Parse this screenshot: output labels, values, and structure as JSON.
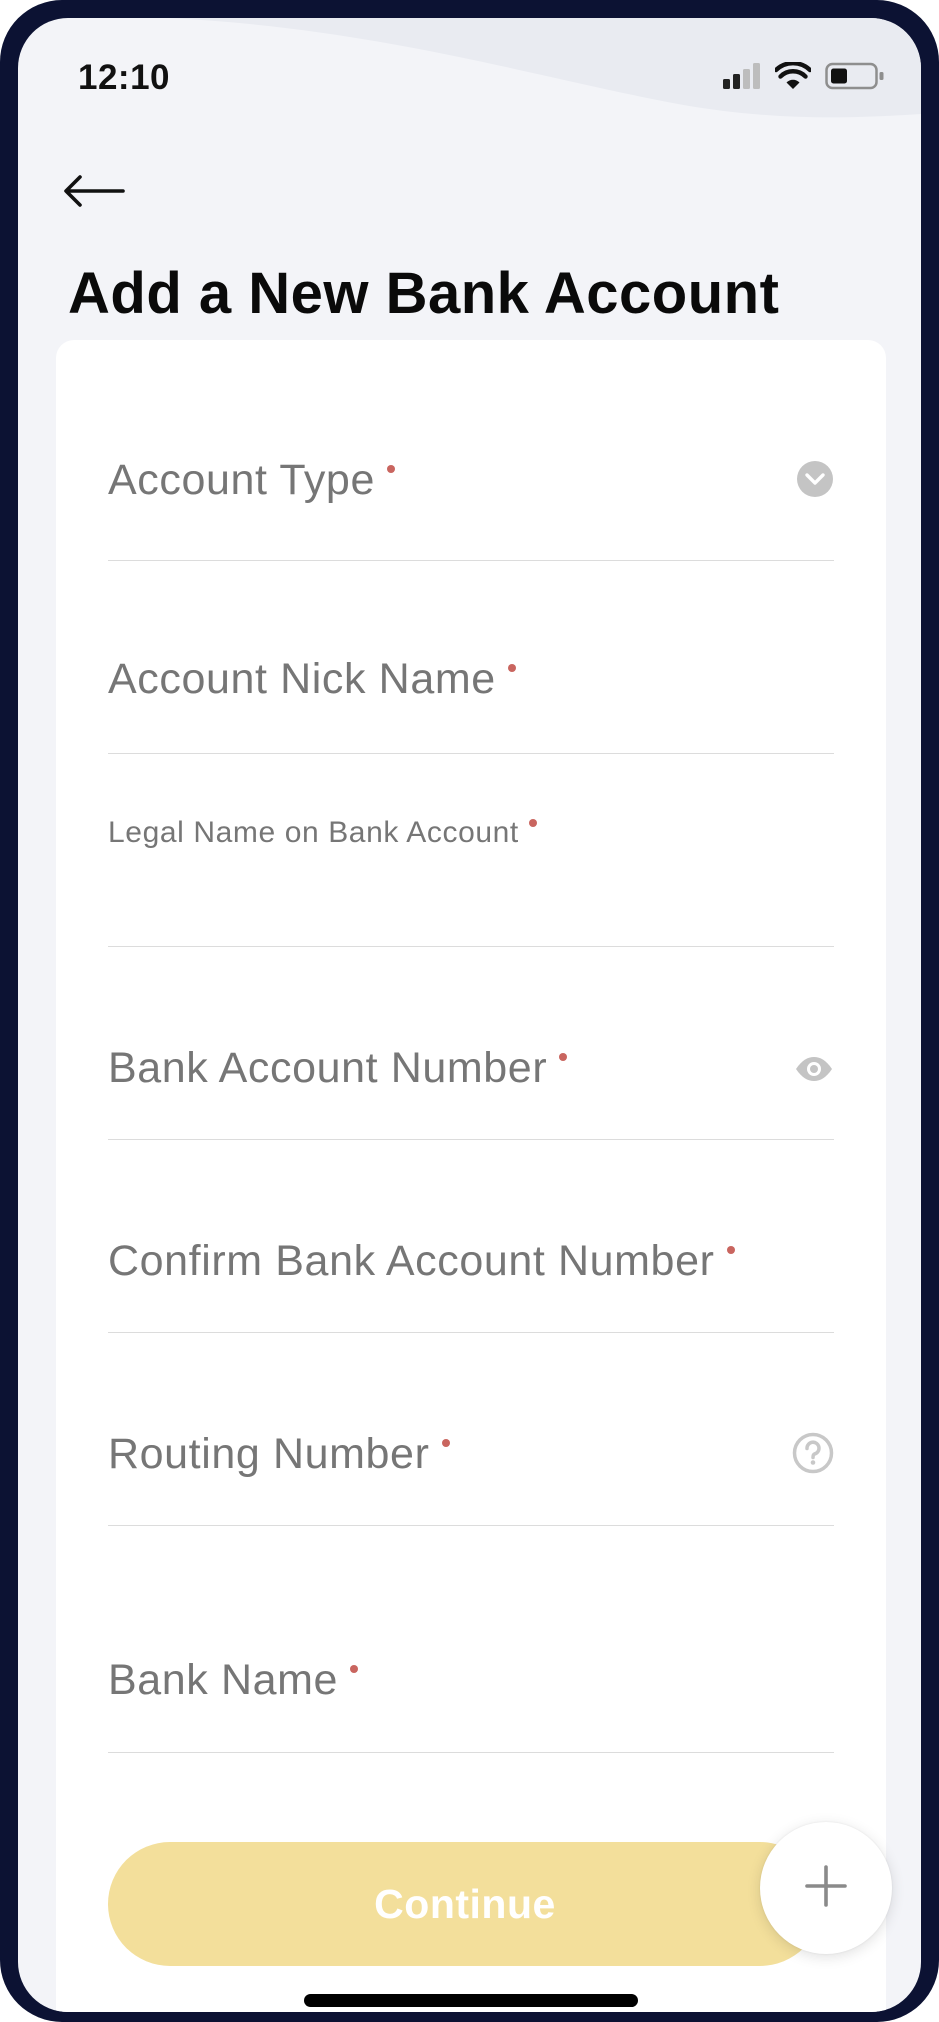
{
  "status_bar": {
    "time": "12:10",
    "icons": [
      "signal-icon",
      "wifi-icon",
      "battery-icon"
    ]
  },
  "header": {
    "back_icon": "arrow-left-icon",
    "title": "Add a New Bank Account"
  },
  "form": {
    "fields": [
      {
        "label": "Account Type",
        "required": true,
        "icon": "chevron-down-circle-icon"
      },
      {
        "label": "Account Nick Name",
        "required": true
      },
      {
        "label": "Legal Name on Bank Account",
        "required": true
      },
      {
        "label": "Bank Account Number",
        "required": true,
        "icon": "eye-icon"
      },
      {
        "label": "Confirm Bank Account Number",
        "required": true
      },
      {
        "label": "Routing Number",
        "required": true,
        "icon": "help-circle-icon"
      },
      {
        "label": "Bank Name",
        "required": true
      }
    ],
    "continue_label": "Continue",
    "fab_icon": "plus-icon"
  },
  "colors": {
    "required_dot": "#c9655f",
    "continue_bg": "#f3df9b",
    "frame": "#0c1233",
    "screen_bg": "#f3f4f8",
    "label_gray": "#767676"
  }
}
